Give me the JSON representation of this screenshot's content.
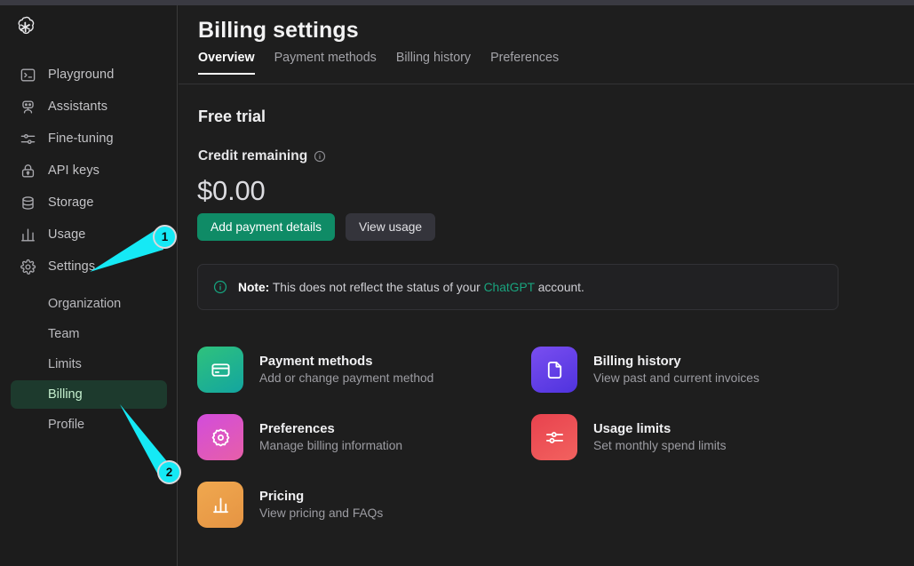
{
  "brand": {
    "logo_icon": "openai-logo"
  },
  "sidebar": {
    "nav": [
      {
        "label": "Playground",
        "icon": "terminal-icon"
      },
      {
        "label": "Assistants",
        "icon": "robot-icon"
      },
      {
        "label": "Fine-tuning",
        "icon": "sliders-icon"
      },
      {
        "label": "API keys",
        "icon": "lock-icon"
      },
      {
        "label": "Storage",
        "icon": "database-icon"
      },
      {
        "label": "Usage",
        "icon": "bar-chart-icon"
      },
      {
        "label": "Settings",
        "icon": "gear-icon"
      }
    ],
    "sub_items": [
      {
        "label": "Organization",
        "active": false
      },
      {
        "label": "Team",
        "active": false
      },
      {
        "label": "Limits",
        "active": false
      },
      {
        "label": "Billing",
        "active": true
      },
      {
        "label": "Profile",
        "active": false
      }
    ],
    "active_color": "#1d3a2d",
    "active_text_color": "#c6f0cf"
  },
  "header": {
    "title": "Billing settings",
    "tabs": [
      {
        "label": "Overview",
        "active": true
      },
      {
        "label": "Payment methods",
        "active": false
      },
      {
        "label": "Billing history",
        "active": false
      },
      {
        "label": "Preferences",
        "active": false
      }
    ]
  },
  "overview": {
    "section_title": "Free trial",
    "credit_label": "Credit remaining",
    "credit_info_icon": "info-icon",
    "credit_amount": "$0.00",
    "buttons": {
      "primary": "Add payment details",
      "secondary": "View usage",
      "primary_color": "#0f8b66",
      "secondary_color": "#34343b"
    },
    "note": {
      "icon": "info-circle-icon",
      "prefix": "Note:",
      "text_before_link": " This does not reflect the status of your ",
      "link": "ChatGPT",
      "text_after_link": " account.",
      "link_color": "#19a47e"
    }
  },
  "cards": [
    {
      "title": "Payment methods",
      "subtitle": "Add or change payment method",
      "icon": "credit-card-icon",
      "color_from": "#2ec27e",
      "color_to": "#16a39a"
    },
    {
      "title": "Billing history",
      "subtitle": "View past and current invoices",
      "icon": "document-icon",
      "color_from": "#7048e8",
      "color_to": "#5136e0"
    },
    {
      "title": "Preferences",
      "subtitle": "Manage billing information",
      "icon": "gear-flower-icon",
      "color_from": "#d94bd6",
      "color_to": "#e05ab0"
    },
    {
      "title": "Usage limits",
      "subtitle": "Set monthly spend limits",
      "icon": "sliders-icon",
      "color_from": "#e8434f",
      "color_to": "#ef5a5a"
    },
    {
      "title": "Pricing",
      "subtitle": "View pricing and FAQs",
      "icon": "bar-chart-icon",
      "color_from": "#efa14b",
      "color_to": "#e99b46"
    }
  ],
  "annotations": {
    "marker_color": "#15e9f5",
    "markers": [
      {
        "number": "1",
        "target": "sidebar-item-settings"
      },
      {
        "number": "2",
        "target": "sidebar-subitem-billing"
      }
    ]
  }
}
